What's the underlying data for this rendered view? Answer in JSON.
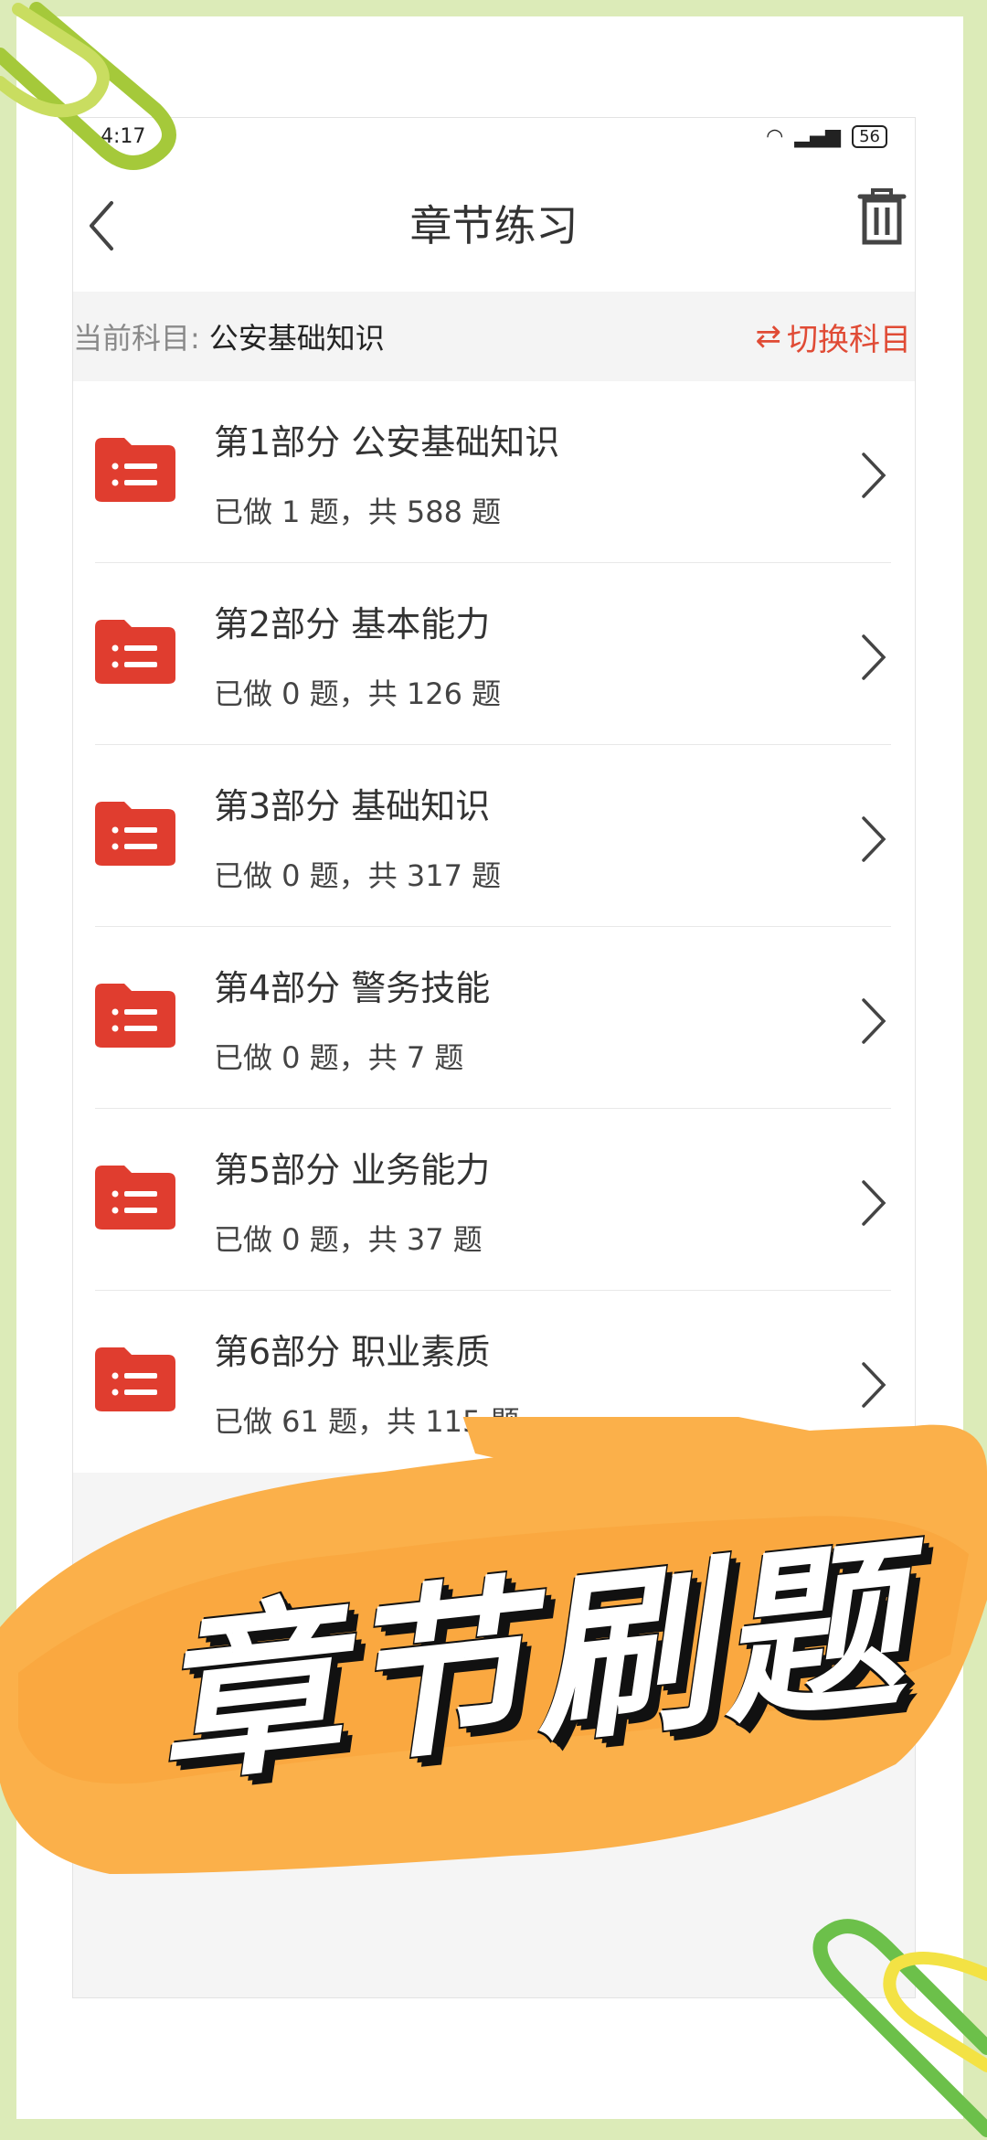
{
  "status_bar": {
    "time": "4:17",
    "battery": "56"
  },
  "navbar": {
    "title": "章节练习"
  },
  "subject": {
    "label": "当前科目:",
    "value": "公安基础知识",
    "switch_label": "切换科目",
    "switch_icon": "⇄"
  },
  "chapters": [
    {
      "title": "第1部分 公安基础知识",
      "progress": "已做 1 题，共 588 题"
    },
    {
      "title": "第2部分 基本能力",
      "progress": "已做 0 题，共 126 题"
    },
    {
      "title": "第3部分 基础知识",
      "progress": "已做 0 题，共 317 题"
    },
    {
      "title": "第4部分 警务技能",
      "progress": "已做 0 题，共 7 题"
    },
    {
      "title": "第5部分 业务能力",
      "progress": "已做 0 题，共 37 题"
    },
    {
      "title": "第6部分 职业素质",
      "progress": "已做 61 题，共 115 题"
    }
  ],
  "overlay": {
    "text": "章节刷题"
  },
  "colors": {
    "accent": "#e03d2f",
    "background": "#dcebb8",
    "brush": "#fbb04a"
  }
}
